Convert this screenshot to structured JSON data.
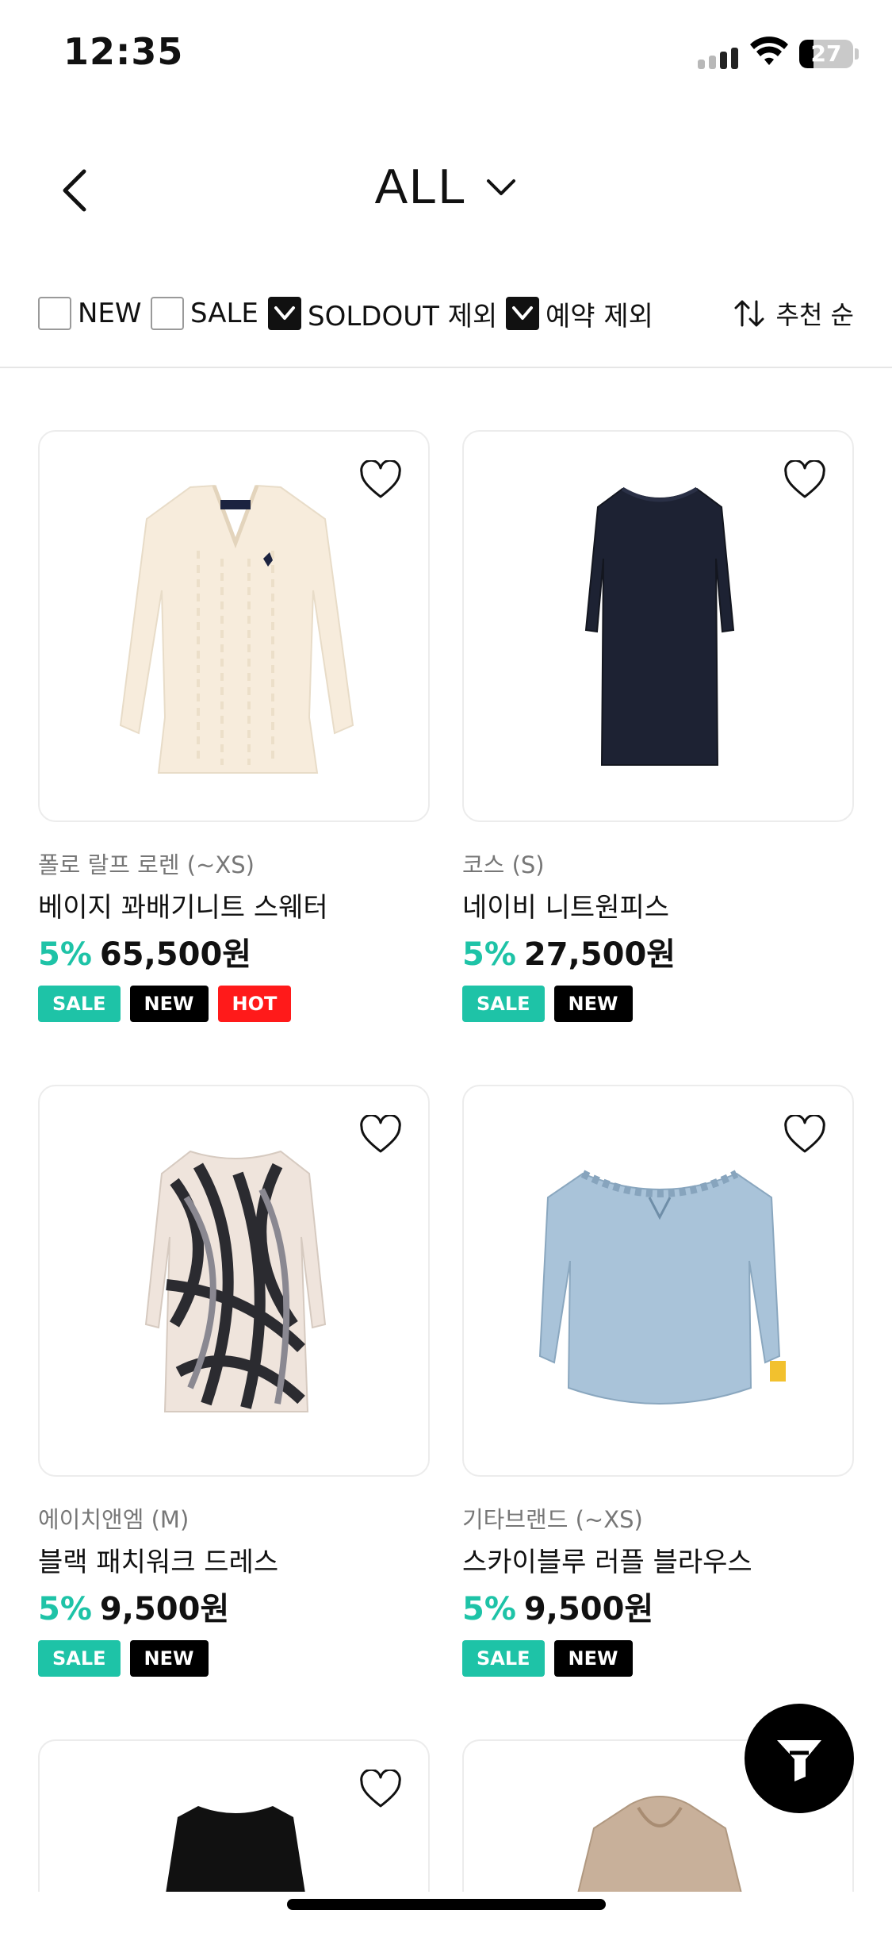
{
  "status_bar": {
    "time": "12:35",
    "battery_level": "27"
  },
  "header": {
    "title": "ALL",
    "back_icon": "chevron-left-icon",
    "dropdown_icon": "chevron-down-icon"
  },
  "filters": {
    "new_label": "NEW",
    "new_checked": false,
    "sale_label": "SALE",
    "sale_checked": false,
    "soldout_label": "SOLDOUT 제외",
    "soldout_checked": true,
    "reserve_label": "예약 제외",
    "reserve_checked": true,
    "sort_label": "추천 순",
    "sort_icon": "sort-arrows-icon"
  },
  "badge_colors": {
    "SALE": "#1ec3a7",
    "NEW": "#000000",
    "HOT": "#ff1a1a"
  },
  "products": [
    {
      "brand": "폴로 랄프 로렌 (~XS)",
      "name": "베이지 꽈배기니트 스웨터",
      "discount": "5%",
      "price": "65,500원",
      "badges": [
        "SALE",
        "NEW",
        "HOT"
      ],
      "image": "beige-cable-sweater"
    },
    {
      "brand": "코스 (S)",
      "name": "네이비  니트원피스",
      "discount": "5%",
      "price": "27,500원",
      "badges": [
        "SALE",
        "NEW"
      ],
      "image": "navy-knit-dress"
    },
    {
      "brand": "에이치앤엠 (M)",
      "name": "블랙 패치워크 드레스",
      "discount": "5%",
      "price": "9,500원",
      "badges": [
        "SALE",
        "NEW"
      ],
      "image": "black-patchwork-dress"
    },
    {
      "brand": "기타브랜드 (~XS)",
      "name": "스카이블루 러플 블라우스",
      "discount": "5%",
      "price": "9,500원",
      "badges": [
        "SALE",
        "NEW"
      ],
      "image": "skyblue-ruffle-blouse"
    },
    {
      "image": "black-top"
    },
    {
      "image": "beige-hoodie"
    }
  ],
  "fab_icon": "filter-funnel-icon"
}
